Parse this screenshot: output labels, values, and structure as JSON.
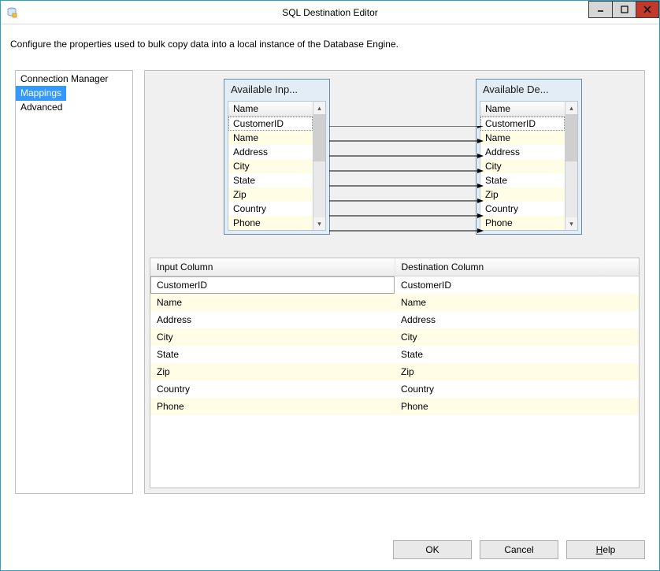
{
  "window": {
    "title": "SQL Destination Editor"
  },
  "description": "Configure the properties used to bulk copy data into a local instance of the Database Engine.",
  "nav": {
    "items": [
      {
        "label": "Connection Manager",
        "selected": false
      },
      {
        "label": "Mappings",
        "selected": true
      },
      {
        "label": "Advanced",
        "selected": false
      }
    ]
  },
  "diagram": {
    "input": {
      "title": "Available Inp...",
      "header": "Name",
      "rows": [
        "CustomerID",
        "Name",
        "Address",
        "City",
        "State",
        "Zip",
        "Country",
        "Phone"
      ]
    },
    "destination": {
      "title": "Available De...",
      "header": "Name",
      "rows": [
        "CustomerID",
        "Name",
        "Address",
        "City",
        "State",
        "Zip",
        "Country",
        "Phone"
      ]
    },
    "selected_row": "CustomerID"
  },
  "mapping_table": {
    "headers": {
      "input": "Input Column",
      "dest": "Destination Column"
    },
    "rows": [
      {
        "input": "CustomerID",
        "dest": "CustomerID",
        "selected": true
      },
      {
        "input": "Name",
        "dest": "Name"
      },
      {
        "input": "Address",
        "dest": "Address"
      },
      {
        "input": "City",
        "dest": "City"
      },
      {
        "input": "State",
        "dest": "State"
      },
      {
        "input": "Zip",
        "dest": "Zip"
      },
      {
        "input": "Country",
        "dest": "Country"
      },
      {
        "input": "Phone",
        "dest": "Phone"
      }
    ]
  },
  "buttons": {
    "ok": "OK",
    "cancel": "Cancel",
    "help": "Help",
    "help_accel": "H"
  }
}
